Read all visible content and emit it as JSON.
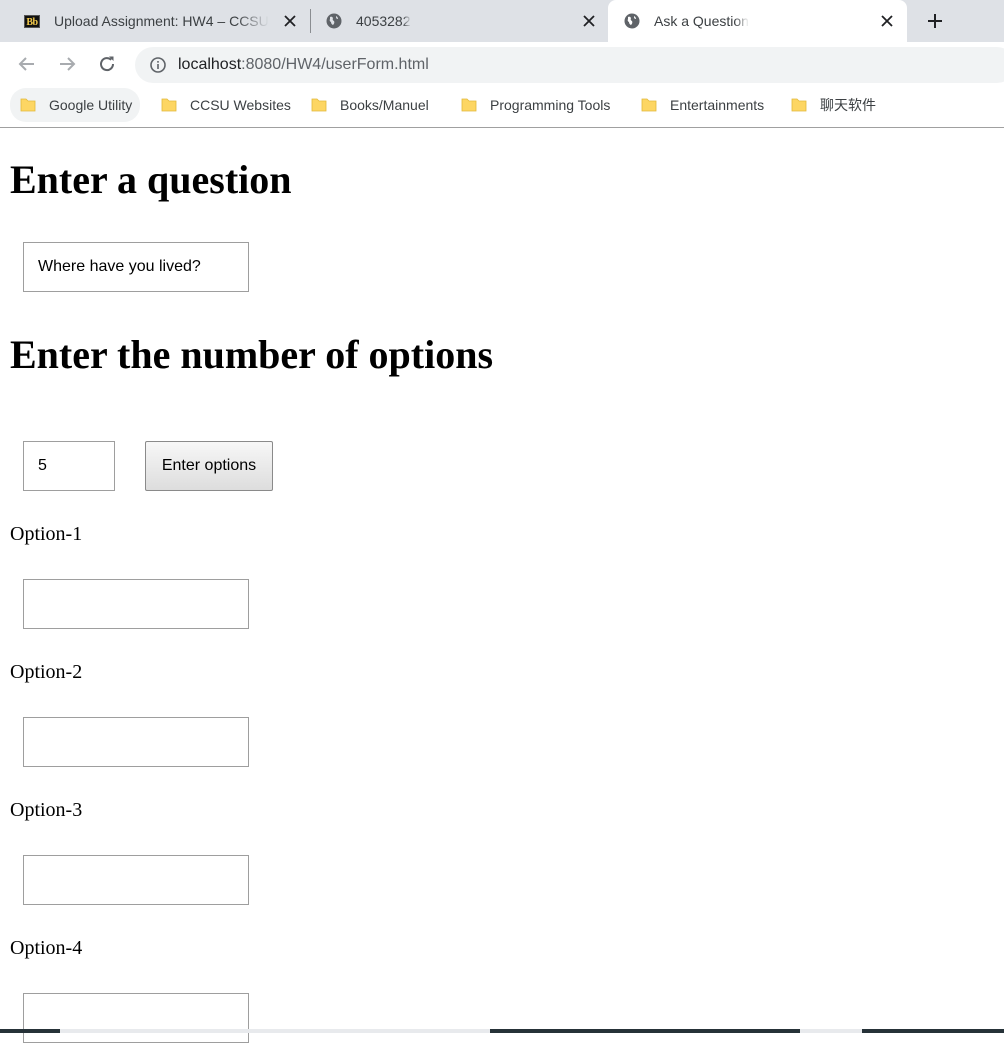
{
  "browser": {
    "tabs": [
      {
        "title": "Upload Assignment: HW4 – CCSU",
        "favicon": "blackboard-icon"
      },
      {
        "title": "4053282",
        "favicon": "globe-icon"
      },
      {
        "title": "Ask a Question",
        "favicon": "globe-icon",
        "active": true
      }
    ],
    "address": {
      "host": "localhost",
      "path": ":8080/HW4/userForm.html"
    },
    "bookmarks": [
      {
        "label": "Google Utility"
      },
      {
        "label": "CCSU Websites"
      },
      {
        "label": "Books/Manuel"
      },
      {
        "label": "Programming Tools"
      },
      {
        "label": "Entertainments"
      },
      {
        "label": "聊天软件"
      }
    ]
  },
  "form": {
    "question_heading": "Enter a question",
    "question_value": "Where have you lived?",
    "options_heading": "Enter the number of options",
    "options_count_value": "5",
    "enter_options_button": "Enter options",
    "options": [
      {
        "label": "Option-1",
        "value": ""
      },
      {
        "label": "Option-2",
        "value": ""
      },
      {
        "label": "Option-3",
        "value": ""
      },
      {
        "label": "Option-4",
        "value": ""
      }
    ]
  },
  "colors": {
    "tabstrip_bg": "#dee1e6",
    "omnibox_bg": "#f1f3f4",
    "folder_yellow": "#fdd663"
  }
}
